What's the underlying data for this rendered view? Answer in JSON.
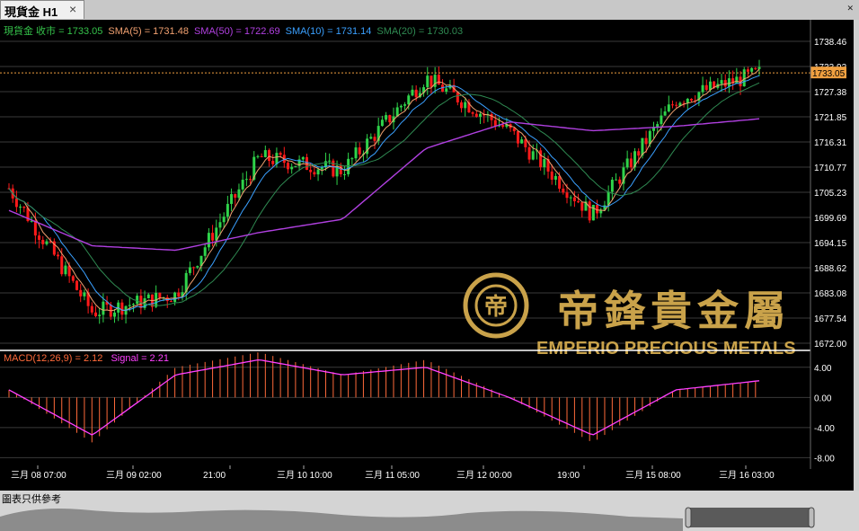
{
  "tab": {
    "label": "現貨金 H1"
  },
  "header": {
    "symbol_label": "現貨金 收市",
    "items": [
      {
        "text": "現貨金 收市 = 1733.05",
        "color": "#35c24a"
      },
      {
        "text": "SMA(5) = 1731.48",
        "color": "#f0a070"
      },
      {
        "text": "SMA(50) = 1722.69",
        "color": "#b040e0"
      },
      {
        "text": "SMA(10) = 1731.14",
        "color": "#3aa0ff"
      },
      {
        "text": "SMA(20) = 1730.03",
        "color": "#2f8a52"
      }
    ]
  },
  "price_axis": {
    "ticks": [
      "1738.46",
      "1733.92",
      "1727.38",
      "1721.85",
      "1716.31",
      "1710.77",
      "1705.23",
      "1699.69",
      "1694.15",
      "1688.62",
      "1683.08",
      "1677.54",
      "1672.00"
    ],
    "current_price": "1733.05"
  },
  "macd": {
    "label": "MACD(12,26,9) = 2.12",
    "signal_label": "Signal = 2.21",
    "label_color": "#ff6a3a",
    "signal_color": "#ff40ff",
    "ticks": [
      "4.00",
      "0.00",
      "-4.00",
      "-8.00"
    ]
  },
  "time_axis": {
    "labels": [
      "三月 08 07:00",
      "三月 09 02:00",
      "21:00",
      "三月 10 10:00",
      "三月 11 05:00",
      "三月 12 00:00",
      "19:00",
      "三月 15 08:00",
      "三月 16 03:00"
    ]
  },
  "watermark": {
    "cn": "帝鋒貴金屬",
    "en": "EMPERIO PRECIOUS METALS",
    "color": "#c9a24a"
  },
  "footer": {
    "disclaimer": "圖表只供參考"
  },
  "colors": {
    "up": "#2fd34a",
    "down": "#ff1a1a",
    "background": "#000000",
    "grid": "#3a3a3a",
    "text": "#ffffff"
  },
  "chart_data": {
    "type": "line",
    "title": "",
    "xlabel": "",
    "ylabel": "",
    "ylim": [
      1672.0,
      1741.0
    ],
    "x": [
      "三月 08 07:00",
      "三月 09 02:00",
      "21:00",
      "三月 10 10:00",
      "三月 11 05:00",
      "三月 12 00:00",
      "19:00",
      "三月 15 08:00",
      "三月 16 03:00"
    ],
    "series": [
      {
        "name": "現貨金 收市",
        "values": [
          1707,
          1679,
          1683,
          1714,
          1711,
          1732,
          1720,
          1701,
          1727,
          1733
        ]
      },
      {
        "name": "SMA(50)",
        "values": [
          1702,
          1694,
          1693,
          1697,
          1700,
          1716,
          1722,
          1720,
          1721,
          1722.69
        ]
      }
    ],
    "macd_ylim": [
      -9.5,
      6
    ],
    "macd_series": [
      {
        "name": "MACD(12,26,9)",
        "values": [
          1,
          -6,
          4,
          6,
          3,
          5,
          0,
          -6,
          1,
          2.12
        ]
      },
      {
        "name": "Signal",
        "values": [
          1,
          -5,
          3,
          5,
          3,
          4,
          0,
          -5,
          1,
          2.21
        ]
      }
    ]
  }
}
